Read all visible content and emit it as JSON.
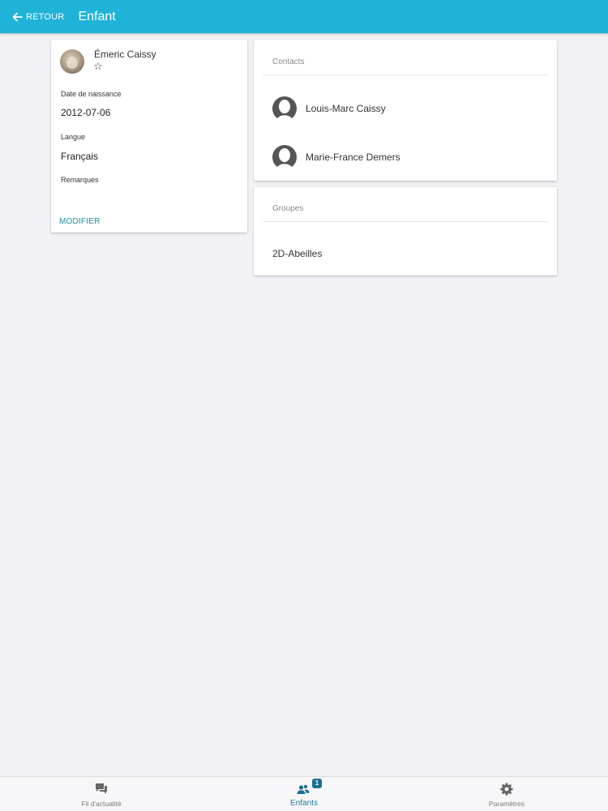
{
  "header": {
    "back_label": "RETOUR",
    "title": "Enfant"
  },
  "child": {
    "name": "Émeric Caissy",
    "favorite_icon": "star-outline",
    "birth_label": "Date de naissance",
    "birth_value": "2012-07-06",
    "language_label": "Langue",
    "language_value": "Français",
    "remarks_label": "Remarques",
    "remarks_value": "",
    "modify_label": "MODIFIER"
  },
  "contacts": {
    "title": "Contacts",
    "items": [
      {
        "name": "Louis-Marc Caissy",
        "icon": "person-silhouette-icon"
      },
      {
        "name": "Marie-France Demers",
        "icon": "person-silhouette-icon"
      }
    ]
  },
  "groups": {
    "title": "Groupes",
    "items": [
      {
        "name": "2D-Abeilles"
      }
    ]
  },
  "tabs": [
    {
      "label": "Fil d'actualité",
      "icon": "chat-bubbles-icon",
      "active": false
    },
    {
      "label": "Enfants",
      "icon": "people-icon",
      "active": true,
      "badge": "1"
    },
    {
      "label": "Paramètres",
      "icon": "gear-icon",
      "active": false
    }
  ],
  "colors": {
    "primary": "#1fb3d8",
    "accent": "#1b8fa3",
    "background": "#f2f1f6"
  }
}
